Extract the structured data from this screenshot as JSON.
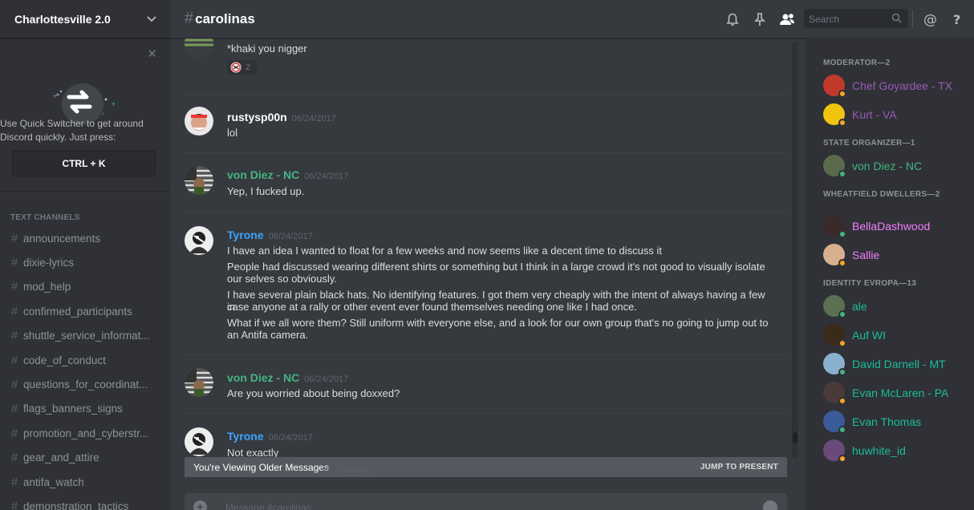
{
  "server": {
    "name": "Charlottesville 2.0"
  },
  "quick_switcher": {
    "line1": "Use Quick Switcher to get around",
    "line2": "Discord quickly. Just press:",
    "shortcut": "CTRL + K"
  },
  "channels": {
    "title": "TEXT CHANNELS",
    "items": [
      {
        "name": "announcements"
      },
      {
        "name": "dixie-lyrics"
      },
      {
        "name": "mod_help"
      },
      {
        "name": "confirmed_participants"
      },
      {
        "name": "shuttle_service_informat..."
      },
      {
        "name": "code_of_conduct"
      },
      {
        "name": "questions_for_coordinat..."
      },
      {
        "name": "flags_banners_signs"
      },
      {
        "name": "promotion_and_cyberstr..."
      },
      {
        "name": "gear_and_attire"
      },
      {
        "name": "antifa_watch"
      },
      {
        "name": "demonstration_tactics"
      }
    ]
  },
  "header": {
    "hash": "#",
    "channel": "carolinas",
    "search_placeholder": "Search"
  },
  "messages": [
    {
      "lines": [
        "*khaki you nigger"
      ],
      "reaction_count": "2"
    },
    {
      "author": "rustysp00n",
      "color": "#ffffff",
      "timestamp": "06/24/2017",
      "lines": [
        "lol"
      ]
    },
    {
      "author": "von Diez - NC",
      "color": "#43b581",
      "timestamp": "06/24/2017",
      "lines": [
        "Yep, I fucked up."
      ]
    },
    {
      "author": "Tyrone",
      "color": "#3ca4ff",
      "timestamp": "06/24/2017",
      "lines": [
        "I have an idea I wanted to float for a few weeks and now seems like a decent time to discuss it",
        "People had discussed wearing different shirts or something but I think in a large crowd it's not good to visually isolate",
        "our selves so obviously.",
        "I have several plain black hats. No identifying features. I got them very cheaply with the intent of always having a few in",
        "case anyone at a rally or other event ever found themselves needing one like I had once.",
        "What if we all wore them? Still uniform with everyone else, and a look for our own group that's no going to jump out to",
        "an Antifa camera."
      ]
    },
    {
      "author": "von Diez - NC",
      "color": "#43b581",
      "timestamp": "06/24/2017",
      "lines": [
        "Are you worried about being doxxed?"
      ]
    },
    {
      "author": "Tyrone",
      "color": "#3ca4ff",
      "timestamp": "06/24/2017",
      "lines": [
        "Not exactly"
      ]
    }
  ],
  "older_banner": {
    "text": "You're Viewing Older Messages",
    "jump": "JUMP TO PRESENT",
    "faded": "re, however"
  },
  "composer": {
    "placeholder": "Message #carolinas"
  },
  "members": {
    "groups": [
      {
        "title": "MODERATOR—2",
        "members": [
          {
            "name": "Chef Goyardee - TX",
            "color": "#9b59b6",
            "status": "#faa61a"
          },
          {
            "name": "Kurt - VA",
            "color": "#9b59b6",
            "status": "#faa61a"
          }
        ]
      },
      {
        "title": "STATE ORGANIZER—1",
        "members": [
          {
            "name": "von Diez - NC",
            "color": "#43b581",
            "status": "#43b581"
          }
        ]
      },
      {
        "title": "WHEATFIELD DWELLERS—2",
        "members": [
          {
            "name": "BellaDashwood",
            "color": "#f47fff",
            "status": "#43b581"
          },
          {
            "name": "Sallie",
            "color": "#f47fff",
            "status": "#faa61a"
          }
        ]
      },
      {
        "title": "IDENTITY EVROPA—13",
        "members": [
          {
            "name": "ale",
            "color": "#1abc9c",
            "status": "#43b581"
          },
          {
            "name": "Auf WI",
            "color": "#1abc9c",
            "status": "#faa61a"
          },
          {
            "name": "David Darnell - MT",
            "color": "#1abc9c",
            "status": "#43b581"
          },
          {
            "name": "Evan McLaren - PA",
            "color": "#1abc9c",
            "status": "#faa61a"
          },
          {
            "name": "Evan Thomas",
            "color": "#1abc9c",
            "status": "#43b581"
          },
          {
            "name": "huwhite_id",
            "color": "#1abc9c",
            "status": "#faa61a"
          }
        ]
      }
    ]
  }
}
